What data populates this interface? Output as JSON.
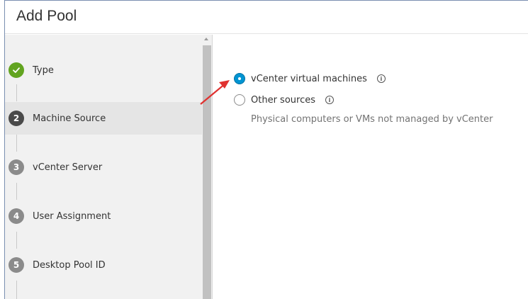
{
  "dialog": {
    "title": "Add Pool"
  },
  "steps": [
    {
      "number": "1",
      "label": "Type",
      "state": "done"
    },
    {
      "number": "2",
      "label": "Machine Source",
      "state": "current"
    },
    {
      "number": "3",
      "label": "vCenter Server",
      "state": "pending"
    },
    {
      "number": "4",
      "label": "User Assignment",
      "state": "pending"
    },
    {
      "number": "5",
      "label": "Desktop Pool ID",
      "state": "pending"
    }
  ],
  "machine_source": {
    "options": [
      {
        "label": "vCenter virtual machines",
        "selected": true,
        "info_icon": "info-icon"
      },
      {
        "label": "Other sources",
        "selected": false,
        "info_icon": "info-icon"
      }
    ],
    "helper_text": "Physical computers or VMs not managed by vCenter"
  },
  "colors": {
    "done": "#62a420",
    "current": "#4a4a4a",
    "pending": "#8b8b8b",
    "radio_selected": "#0094d2",
    "annotation_arrow": "#e0312f"
  }
}
